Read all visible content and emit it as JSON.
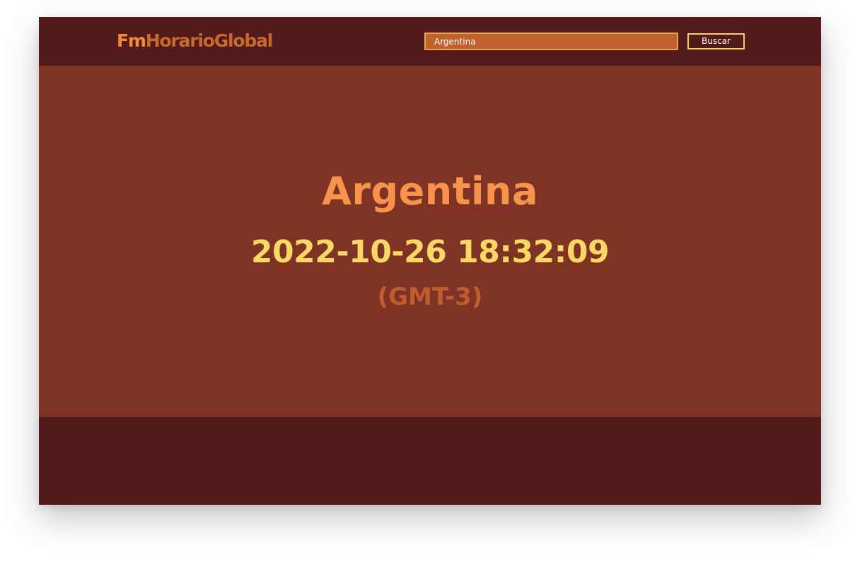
{
  "header": {
    "logo_prefix": "Fm",
    "logo_rest": "HorarioGlobal",
    "search_value": "Argentina",
    "search_button_label": "Buscar"
  },
  "main": {
    "country": "Argentina",
    "datetime": "2022-10-26 18:32:09",
    "timezone": "(GMT-3)"
  },
  "colors": {
    "header_bg": "#521a1a",
    "main_bg": "#7f3325",
    "country_text": "#f7934a",
    "datetime_text": "#f9d864",
    "timezone_text": "#bf5e2c",
    "search_bg": "#c0622e",
    "button_border": "#f4d06a"
  }
}
